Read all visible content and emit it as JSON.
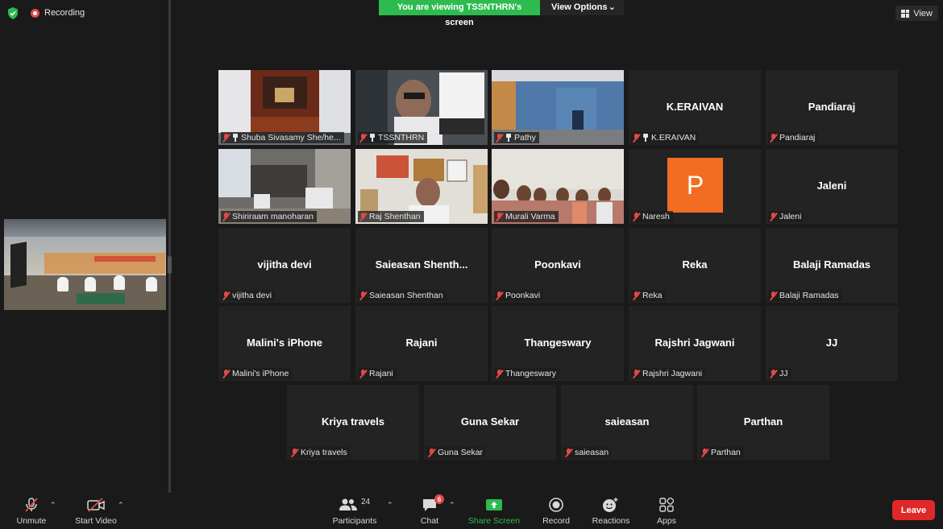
{
  "status": {
    "recording_label": "Recording"
  },
  "banner": {
    "viewing_text": "You are viewing TSSNTHRN's screen",
    "view_options_label": "View Options"
  },
  "top_right": {
    "view_label": "View"
  },
  "tiles": [
    {
      "display": "",
      "label": "Shuba Sivasamy She/he...",
      "pinned": true
    },
    {
      "display": "",
      "label": "TSSNTHRN",
      "pinned": true
    },
    {
      "display": "",
      "label": "Pathy",
      "pinned": false
    },
    {
      "display": "K.ERAIVAN",
      "label": "K.ERAIVAN",
      "pinned": true
    },
    {
      "display": "Pandiaraj",
      "label": "Pandiaraj",
      "pinned": false
    },
    {
      "display": "",
      "label": "Shiriraam manoharan",
      "pinned": false
    },
    {
      "display": "",
      "label": "Raj Shenthan",
      "pinned": false
    },
    {
      "display": "",
      "label": "Murali Varma",
      "pinned": false
    },
    {
      "display": "P",
      "label": "Naresh",
      "pinned": false
    },
    {
      "display": "Jaleni",
      "label": "Jaleni",
      "pinned": false
    },
    {
      "display": "vijitha devi",
      "label": "vijitha devi",
      "pinned": false
    },
    {
      "display": "Saieasan  Shenth...",
      "label": "Saieasan Shenthan",
      "pinned": false
    },
    {
      "display": "Poonkavi",
      "label": "Poonkavi",
      "pinned": false
    },
    {
      "display": "Reka",
      "label": "Reka",
      "pinned": false
    },
    {
      "display": "Balaji Ramadas",
      "label": "Balaji Ramadas",
      "pinned": false
    },
    {
      "display": "Malini's iPhone",
      "label": "Malini's iPhone",
      "pinned": false
    },
    {
      "display": "Rajani",
      "label": "Rajani",
      "pinned": false
    },
    {
      "display": "Thangeswary",
      "label": "Thangeswary",
      "pinned": false
    },
    {
      "display": "Rajshri Jagwani",
      "label": "Rajshri Jagwani",
      "pinned": false
    },
    {
      "display": "JJ",
      "label": "JJ",
      "pinned": false
    },
    {
      "display": "Kriya travels",
      "label": "Kriya travels",
      "pinned": false
    },
    {
      "display": "Guna Sekar",
      "label": "Guna Sekar",
      "pinned": false
    },
    {
      "display": "saieasan",
      "label": "saieasan",
      "pinned": false
    },
    {
      "display": "Parthan",
      "label": "Parthan",
      "pinned": false
    }
  ],
  "toolbar": {
    "unmute": "Unmute",
    "start_video": "Start Video",
    "participants": "Participants",
    "participants_count": "24",
    "chat": "Chat",
    "chat_badge": "6",
    "share_screen": "Share Screen",
    "record": "Record",
    "reactions": "Reactions",
    "apps": "Apps",
    "leave": "Leave"
  },
  "colors": {
    "accent_green": "#2dba4e",
    "leave_red": "#e02828",
    "muted_red": "#e34848",
    "active_speaker": "#c8e05a",
    "avatar_orange": "#f26d21"
  }
}
